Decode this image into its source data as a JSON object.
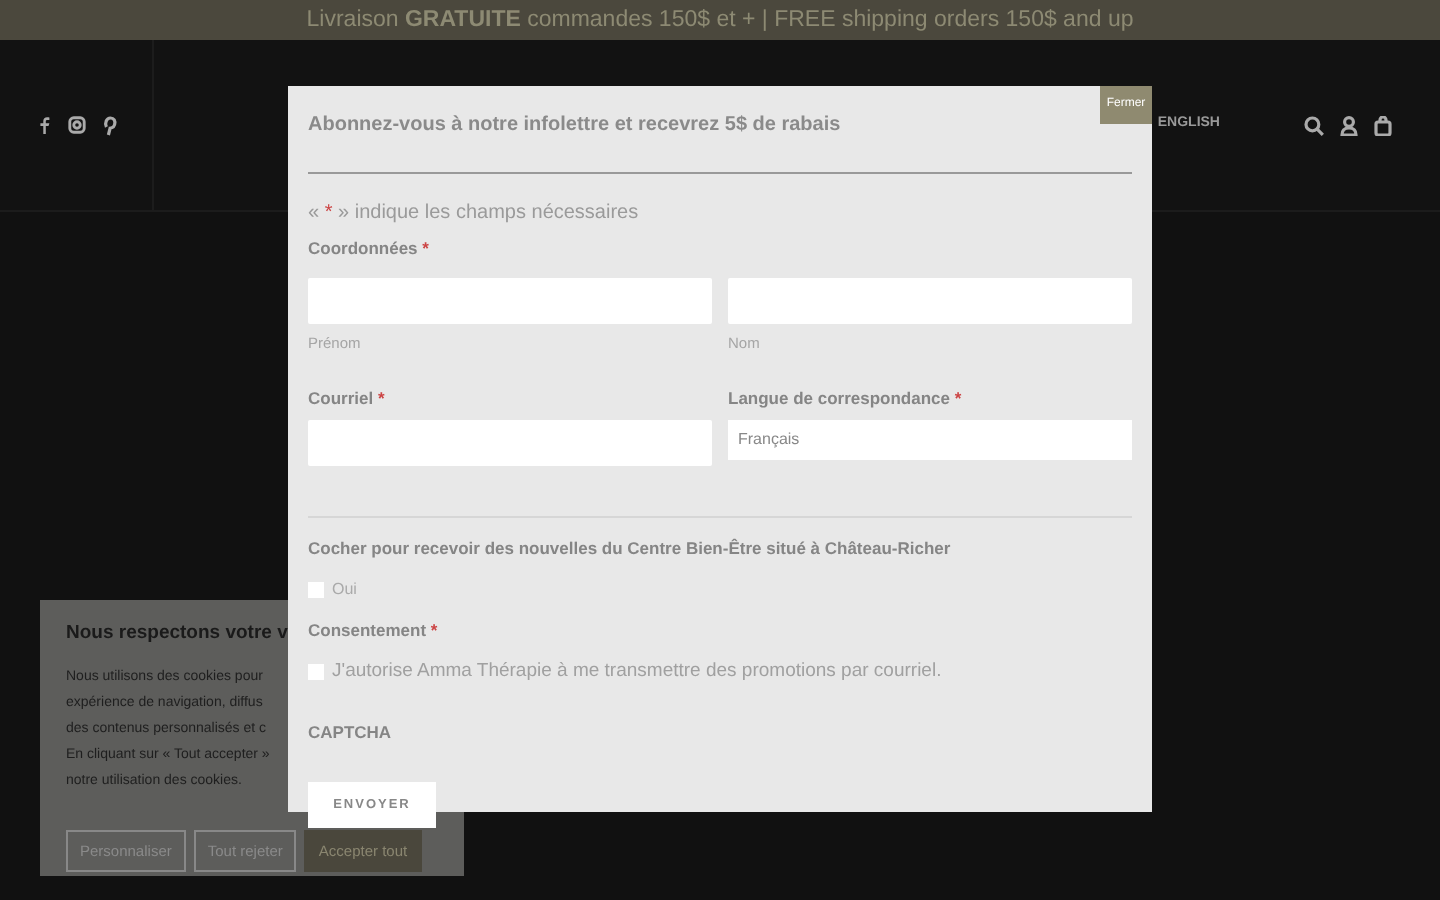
{
  "announcement": "Livraison **GRATUITE** commandes 150$ et + | FREE shipping orders 150$ and up",
  "header": {
    "language_link": "ENGLISH"
  },
  "modal": {
    "close_label": "Fermer",
    "title": "Abonnez-vous à notre infolettre et recevrez 5$ de rabais",
    "legend": {
      "before": "« ",
      "mark": "*",
      "after": " » indique les champs nécessaires"
    },
    "name_group": {
      "label": "Coordonnées",
      "mark": "*",
      "fields": [
        {
          "sublabel": "Prénom"
        },
        {
          "sublabel": "Nom"
        }
      ]
    },
    "email": {
      "label": "Courriel",
      "mark": "*"
    },
    "language": {
      "label": "Langue de correspondance",
      "mark": "*",
      "value": "Français"
    },
    "news": {
      "label": "Cocher pour recevoir des nouvelles du Centre Bien-Être situé à Château-Richer",
      "option": "Oui",
      "checked": false
    },
    "consent": {
      "label": "Consentement",
      "mark": "*",
      "option": "J'autorise Amma Thérapie à me transmettre des promotions par courriel.",
      "checked": false
    },
    "captcha": {
      "label": "CAPTCHA"
    },
    "submit": "ENVOYER"
  },
  "cookie_banner": {
    "title": "Nous respectons votre v",
    "lines": [
      "Nous utilisons des cookies pour",
      "expérience de navigation, diffus",
      "des contenus personnalisés et c",
      "En cliquant sur « Tout accepter »",
      "notre utilisation des cookies."
    ],
    "buttons": [
      {
        "label": "Personnaliser",
        "kind": "outline"
      },
      {
        "label": "Tout rejeter",
        "kind": "outline"
      },
      {
        "label": "Accepter tout",
        "kind": "filled"
      }
    ]
  }
}
